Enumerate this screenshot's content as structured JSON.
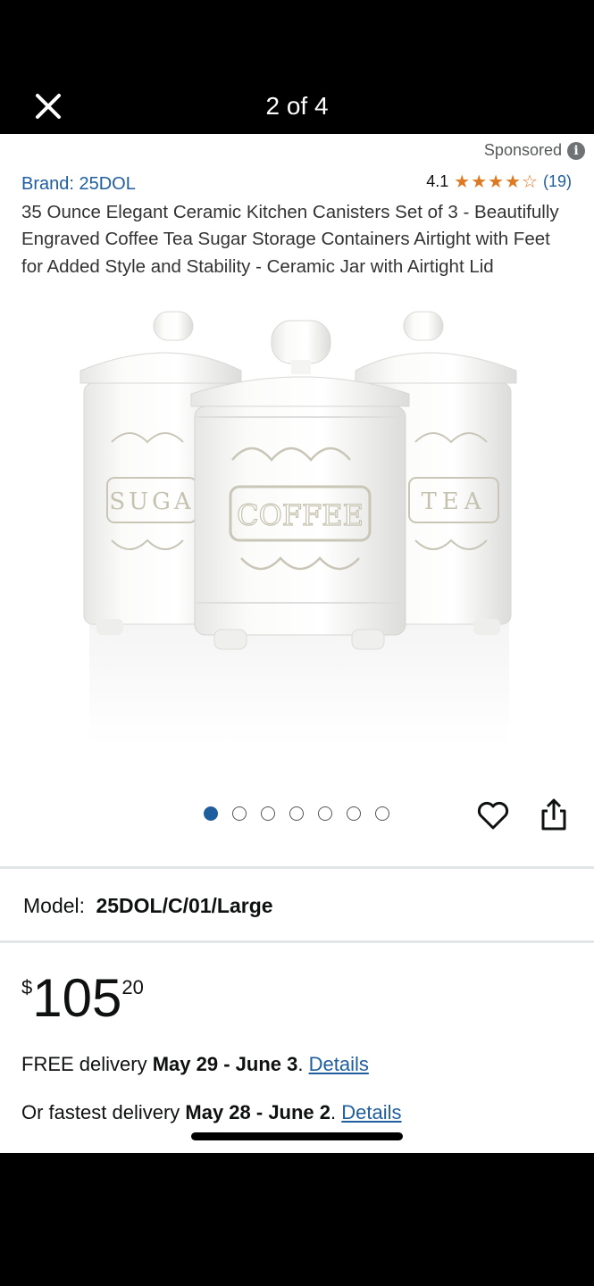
{
  "topbar": {
    "pager_text": "2 of 4",
    "close_icon": "close-icon"
  },
  "sponsored": {
    "label": "Sponsored",
    "info_icon_glyph": "i"
  },
  "product": {
    "brand": "Brand: 25DOL",
    "rating_value": "4.1",
    "rating_stars": 4.1,
    "stars": [
      "★",
      "★",
      "★",
      "★",
      "☆"
    ],
    "rating_count": "(19)",
    "title": "35 Ounce Elegant Ceramic Kitchen Canisters Set of 3 - Beautifully Engraved Coffee Tea Sugar Storage Containers Airtight with Feet for Added Style and Stability - Ceramic Jar with Airtight Lid",
    "image_labels": {
      "left": "SUGA",
      "center": "COFFEE",
      "right": "TEA"
    }
  },
  "carousel": {
    "total_dots": 7,
    "active_index": 0
  },
  "actions": {
    "heart_icon": "heart-icon",
    "share_icon": "share-icon"
  },
  "model": {
    "label": "Model:",
    "value": "25DOL/C/01/Large"
  },
  "price": {
    "symbol": "$",
    "whole": "105",
    "fraction": "20"
  },
  "delivery": {
    "free_prefix": "FREE delivery ",
    "free_dates": "May 29 - June 3",
    "free_suffix": ". ",
    "free_link": "Details",
    "fast_prefix": "Or fastest delivery ",
    "fast_dates": "May 28 - June 2",
    "fast_suffix": ". ",
    "fast_link": "Details"
  },
  "colors": {
    "link": "#1f5e9e",
    "star": "#de7921",
    "dot_active": "#1f5e9e"
  }
}
